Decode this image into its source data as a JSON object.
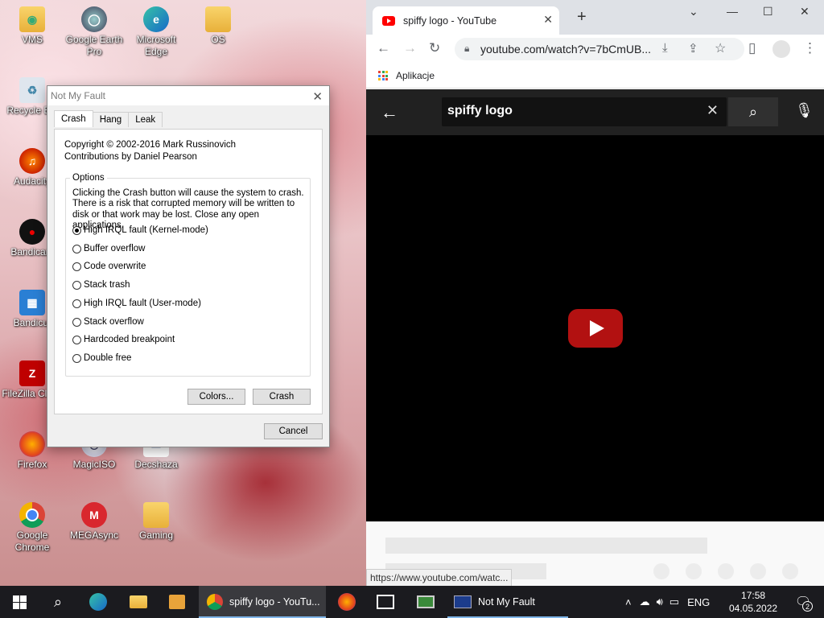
{
  "desktop_icons": [
    {
      "label": "VMS",
      "icon": "folder-user-icon"
    },
    {
      "label": "Google Earth Pro",
      "icon": "google-earth-icon"
    },
    {
      "label": "Microsoft Edge",
      "icon": "edge-icon"
    },
    {
      "label": "OS",
      "icon": "folder-icon"
    },
    {
      "label": "Recycle Bin",
      "icon": "recycle-bin-icon"
    },
    {
      "label": "Audacity",
      "icon": "audacity-icon"
    },
    {
      "label": "Bandicam",
      "icon": "bandicam-icon"
    },
    {
      "label": "Bandicut",
      "icon": "bandicut-icon"
    },
    {
      "label": "FileZilla Client",
      "icon": "filezilla-icon"
    },
    {
      "label": "Firefox",
      "icon": "firefox-icon"
    },
    {
      "label": "MagicISO",
      "icon": "magiciso-icon"
    },
    {
      "label": "Decshaza",
      "icon": "decshaza-icon"
    },
    {
      "label": "Google Chrome",
      "icon": "chrome-icon"
    },
    {
      "label": "MEGAsync",
      "icon": "mega-icon"
    },
    {
      "label": "Gaming",
      "icon": "folder-icon"
    }
  ],
  "dialog": {
    "title": "Not My Fault",
    "tabs": [
      "Crash",
      "Hang",
      "Leak"
    ],
    "active_tab": "Crash",
    "copyright": "Copyright © 2002-2016 Mark Russinovich",
    "contributions": "Contributions by Daniel Pearson",
    "options_label": "Options",
    "options_desc": "Clicking the Crash button will cause the system to crash. There is a risk that corrupted memory will be written to disk or that work may be lost. Close any open applications.",
    "radios": [
      {
        "label": "High IRQL fault (Kernel-mode)",
        "checked": true
      },
      {
        "label": "Buffer overflow",
        "checked": false
      },
      {
        "label": "Code overwrite",
        "checked": false
      },
      {
        "label": "Stack trash",
        "checked": false
      },
      {
        "label": "High IRQL fault (User-mode)",
        "checked": false
      },
      {
        "label": "Stack overflow",
        "checked": false
      },
      {
        "label": "Hardcoded breakpoint",
        "checked": false
      },
      {
        "label": "Double free",
        "checked": false
      }
    ],
    "colors_button": "Colors...",
    "crash_button": "Crash",
    "cancel_button": "Cancel"
  },
  "browser": {
    "tab_title": "spiffy logo - YouTube",
    "url": "youtube.com/watch?v=7bCmUB...",
    "bookmark_apps": "Aplikacje",
    "search_query": "spiffy logo",
    "status_url": "https://www.youtube.com/watc...",
    "accent": "#ff0000"
  },
  "taskbar": {
    "chrome_label": "spiffy logo - YouTu...",
    "nmf_label": "Not My Fault",
    "lang": "ENG",
    "time": "17:58",
    "date": "04.05.2022",
    "notifications": "2"
  }
}
